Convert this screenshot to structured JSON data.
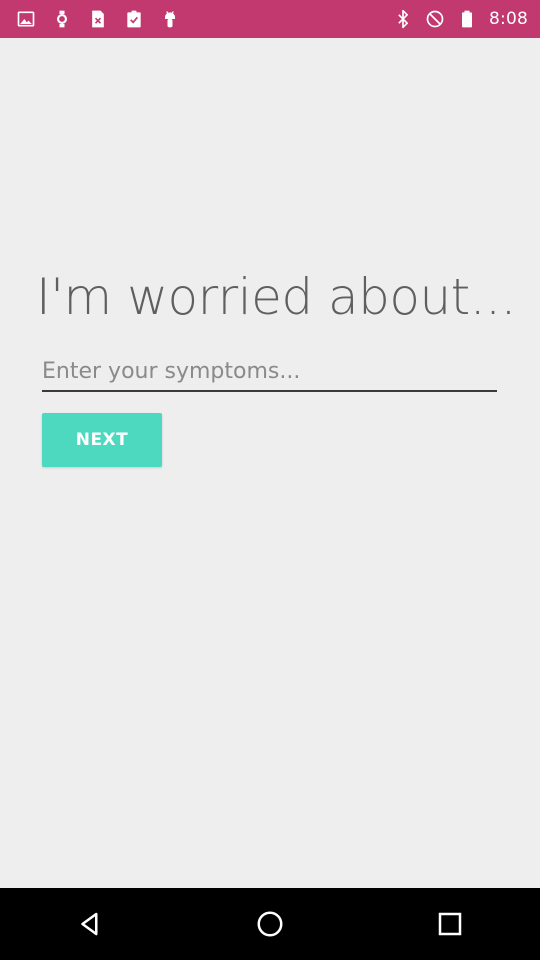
{
  "colors": {
    "status_bar": "#c2396f",
    "background": "#eeeeee",
    "accent": "#4dd8c0",
    "nav_bar": "#000000"
  },
  "status_bar": {
    "left_icons": [
      "image-icon",
      "watch-icon",
      "doc-close-icon",
      "clipboard-check-icon",
      "android-icon"
    ],
    "right_icons": [
      "bluetooth-icon",
      "do-not-disturb-icon",
      "battery-icon"
    ],
    "time": "8:08"
  },
  "main": {
    "headline": "I'm worried about...",
    "symptom_input": {
      "placeholder": "Enter your symptoms...",
      "value": ""
    },
    "next_label": "NEXT"
  },
  "nav_bar": {
    "icons": [
      "back-icon",
      "home-icon",
      "recents-icon"
    ]
  }
}
